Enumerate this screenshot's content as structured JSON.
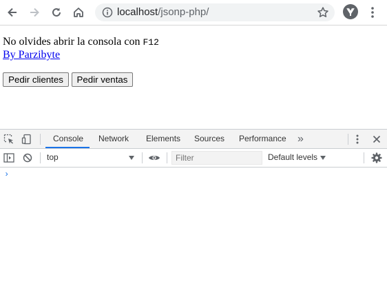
{
  "browser": {
    "url_host": "localhost",
    "url_path": "/jsonp-php/",
    "icons": {
      "back": "arrow-left-icon",
      "forward": "arrow-right-icon",
      "reload": "reload-icon",
      "home": "home-icon",
      "info": "info-icon",
      "star": "star-icon",
      "profile": "avatar",
      "menu": "kebab-menu-icon"
    }
  },
  "page": {
    "intro_text": "No olvides abrir la consola con ",
    "intro_key": "F12",
    "link_text": "By Parzibyte",
    "buttons": {
      "clients": "Pedir clientes",
      "sales": "Pedir ventas"
    },
    "link_color": "#0000ee"
  },
  "devtools": {
    "tabs": [
      "Console",
      "Network",
      "Elements",
      "Sources",
      "Performance"
    ],
    "more_tabs_glyph": "»",
    "active_tab": "Console",
    "context": "top",
    "filter_placeholder": "Filter",
    "levels_label": "Default levels",
    "prompt_glyph": "›",
    "accent_color": "#1a73e8"
  }
}
